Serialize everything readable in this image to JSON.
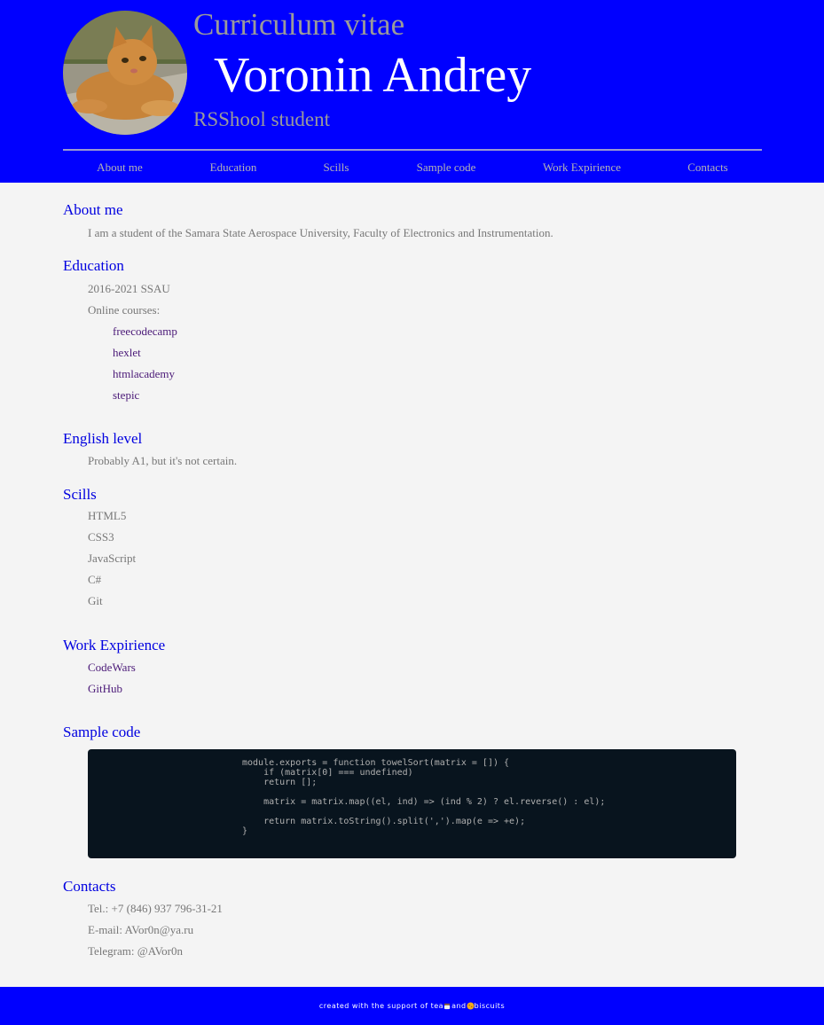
{
  "header": {
    "cv_label": "Curriculum vitae",
    "name": "Voronin Andrey",
    "subtitle": "RSShool student",
    "avatar_alt": "cat-photo"
  },
  "nav": {
    "items": [
      "About me",
      "Education",
      "Scills",
      "Sample code",
      "Work Expirience",
      "Contacts"
    ]
  },
  "about": {
    "title": "About me",
    "text": "I am a student of the Samara State Aerospace University, Faculty of Electronics and Instrumentation."
  },
  "education": {
    "title": "Education",
    "university": "2016-2021 SSAU",
    "online_label": "Online courses:",
    "courses": [
      "freecodecamp",
      "hexlet",
      "htmlacademy",
      "stepic"
    ]
  },
  "english": {
    "title": "English level",
    "text": "Probably A1, but it's not certain."
  },
  "skills": {
    "title": "Scills",
    "items": [
      "HTML5",
      "CSS3",
      "JavaScript",
      "C#",
      "Git"
    ]
  },
  "work": {
    "title": "Work Expirience",
    "links": [
      "CodeWars",
      "GitHub"
    ]
  },
  "sample": {
    "title": "Sample code",
    "code": "module.exports = function towelSort(matrix = []) {\n    if (matrix[0] === undefined)\n    return [];\n\n    matrix = matrix.map((el, ind) => (ind % 2) ? el.reverse() : el);\n\n    return matrix.toString().split(',').map(e => +e);\n}"
  },
  "contacts": {
    "title": "Contacts",
    "phone": "Tel.: +7 (846) 937 796-31-21",
    "email": "E-mail: AVor0n@ya.ru",
    "telegram": "Telegram: @AVor0n"
  },
  "footer": {
    "text_a": "created with the support of tea",
    "text_b": "and",
    "text_c": "biscuits"
  },
  "colors": {
    "header_bg": "#0000ff",
    "heading": "#0000e0",
    "link": "#4b1a78",
    "code_bg": "#08141e"
  }
}
